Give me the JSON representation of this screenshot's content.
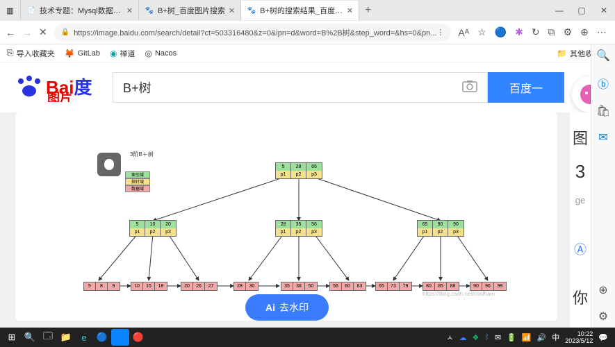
{
  "tabs": [
    {
      "label": "技术专题：Mysql数据库（视图...",
      "icon": "📄"
    },
    {
      "label": "B+树_百度图片搜索",
      "icon": "🐾"
    },
    {
      "label": "B+树的搜索结果_百度图片搜索",
      "icon": "🐾",
      "active": true
    }
  ],
  "window_controls": {
    "min": "—",
    "max": "▢",
    "close": "✕"
  },
  "url": {
    "lock": "🔒",
    "text": "https://image.baidu.com/search/detail?ct=503316480&z=0&ipn=d&word=B%2B树&step_word=&hs=0&pn...",
    "star": "☆"
  },
  "urlicons": [
    "⟳",
    "Aᴬ",
    "☆",
    "🔵",
    "⊞",
    "↻",
    "⌂",
    "⚙",
    "+",
    "⋯",
    "⬜"
  ],
  "bookmarks": [
    {
      "icon": "⎘",
      "label": "导入收藏夹"
    },
    {
      "icon": "🦊",
      "label": "GitLab",
      "color": "#e24329"
    },
    {
      "icon": "◉",
      "label": "禅道",
      "color": "#0aa"
    },
    {
      "icon": "◎",
      "label": "Nacos",
      "color": "#333"
    }
  ],
  "bookmarks_right": {
    "icon": "📁",
    "label": "其他收藏夹"
  },
  "search": {
    "value": "B+树",
    "button": "百度一",
    "camera": "📷"
  },
  "diagram": {
    "title": "3阶B＋树",
    "legend": [
      "索引域",
      "指针域",
      "数据域"
    ],
    "root": {
      "keys": [
        "5",
        "28",
        "65"
      ],
      "ptrs": [
        "p1",
        "p2",
        "p3"
      ]
    },
    "mids": [
      {
        "keys": [
          "5",
          "10",
          "20"
        ],
        "ptrs": [
          "p1",
          "p2",
          "p3"
        ]
      },
      {
        "keys": [
          "28",
          "35",
          "56"
        ],
        "ptrs": [
          "p1",
          "p2",
          "p3"
        ]
      },
      {
        "keys": [
          "65",
          "80",
          "90"
        ],
        "ptrs": [
          "p1",
          "p2",
          "p3"
        ]
      }
    ],
    "leaves": [
      [
        "5",
        "8",
        "9"
      ],
      [
        "10",
        "15",
        "18"
      ],
      [
        "20",
        "26",
        "27"
      ],
      [
        "28",
        "30"
      ],
      [
        "35",
        "38",
        "50"
      ],
      [
        "56",
        "60",
        "63"
      ],
      [
        "65",
        "73",
        "79"
      ],
      [
        "80",
        "85",
        "88"
      ],
      [
        "90",
        "96",
        "99"
      ]
    ]
  },
  "rside": [
    "图",
    "3",
    "ge"
  ],
  "rside2": "你",
  "pill": {
    "icon": "Ai",
    "text": "去水印"
  },
  "watermark": "https://blog.csdn.net/coolham",
  "edgeicons": [
    "🔍",
    "💬",
    "🛒",
    "⊕",
    "⚙"
  ],
  "taskbar_left": [
    "⊞",
    "🔍",
    "🗔",
    "📁",
    "🌐",
    "🔵",
    "🟢",
    "🔴"
  ],
  "tray": {
    "icons": [
      "ㅅ",
      "🔵",
      "⚪",
      "🔋",
      "🔊",
      "中"
    ],
    "time": "10:22",
    "date": "2023/5/12"
  },
  "nav": {
    "back": "←",
    "fwd": "→",
    "stop": "✕"
  }
}
